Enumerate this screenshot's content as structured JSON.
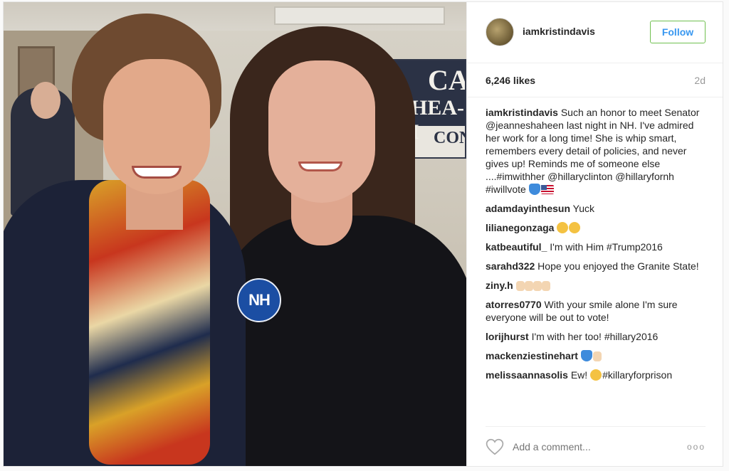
{
  "post": {
    "username": "iamkristindavis",
    "follow_label": "Follow",
    "likes": "6,246 likes",
    "time": "2d",
    "badge_text": "NH"
  },
  "comments": [
    {
      "user": "iamkristindavis",
      "text": "Such an honor to meet Senator @jeanneshaheen last night in NH. I've admired her work for a long time! She is whip smart, remembers every detail of policies, and never gives up! Reminds me of someone else ....#imwithher @hillaryclinton @hillaryfornh #iwillvote",
      "emoji": [
        "blue-heart",
        "flag"
      ]
    },
    {
      "user": "adamdayinthesun",
      "text": "Yuck",
      "emoji": []
    },
    {
      "user": "lilianegonzaga",
      "text": "",
      "emoji": [
        "heart-eyes",
        "heart-eyes"
      ]
    },
    {
      "user": "katbeautiful_",
      "text": "I'm with Him #Trump2016",
      "emoji": []
    },
    {
      "user": "sarahd322",
      "text": "Hope you enjoyed the Granite State!",
      "emoji": []
    },
    {
      "user": "ziny.h",
      "text": "",
      "emoji": [
        "thumb",
        "thumb",
        "thumb",
        "thumb"
      ]
    },
    {
      "user": "atorres0770",
      "text": "With your smile alone I'm sure everyone will be out to vote!",
      "emoji": []
    },
    {
      "user": "lorijhurst",
      "text": "I'm with her too! #hillary2016",
      "emoji": []
    },
    {
      "user": "mackenziestinehart",
      "text": "",
      "emoji": [
        "blue-heart",
        "thumb"
      ]
    },
    {
      "user": "melissaannasolis",
      "text": "Ew!",
      "text_after": "#killaryforprison",
      "emoji": [
        "mask"
      ]
    }
  ],
  "add_comment": {
    "placeholder": "Add a comment..."
  },
  "more_label": "ooo",
  "colors": {
    "follow_text": "#3897f0",
    "follow_border": "#70c050"
  }
}
